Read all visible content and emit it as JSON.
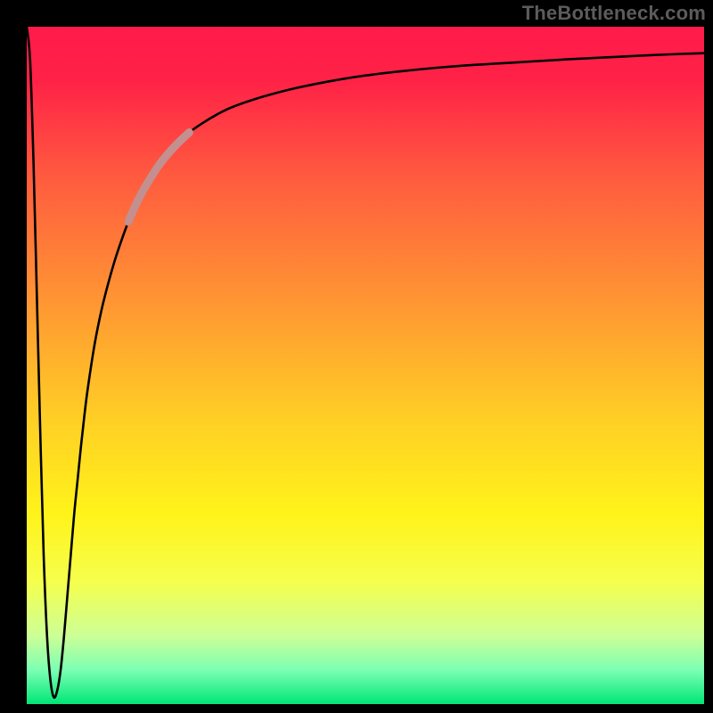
{
  "watermark": "TheBottleneck.com",
  "chart_data": {
    "type": "line",
    "title": "",
    "xlabel": "",
    "ylabel": "",
    "xlim": [
      0,
      100
    ],
    "ylim": [
      0,
      100
    ],
    "gradient_stops": [
      {
        "pos": 0.0,
        "color": "#ff1a4a"
      },
      {
        "pos": 0.08,
        "color": "#ff2247"
      },
      {
        "pos": 0.22,
        "color": "#ff5a3f"
      },
      {
        "pos": 0.4,
        "color": "#ff9433"
      },
      {
        "pos": 0.58,
        "color": "#ffcf25"
      },
      {
        "pos": 0.72,
        "color": "#fff31a"
      },
      {
        "pos": 0.82,
        "color": "#f5ff4d"
      },
      {
        "pos": 0.9,
        "color": "#ccff97"
      },
      {
        "pos": 0.95,
        "color": "#7bffb3"
      },
      {
        "pos": 1.0,
        "color": "#00e676"
      }
    ],
    "series": [
      {
        "name": "curve",
        "color": "#000000",
        "highlight_color": "#c48f8f",
        "highlight_range_x": [
          15,
          24
        ],
        "x": [
          0.0,
          0.5,
          1.0,
          1.5,
          2.0,
          2.5,
          3.0,
          3.5,
          4.0,
          4.5,
          5.0,
          5.5,
          6.0,
          6.5,
          7.0,
          7.5,
          8.0,
          8.5,
          9.0,
          10.0,
          11.0,
          12.0,
          13.0,
          14.0,
          15.0,
          16.0,
          17.0,
          18.0,
          19.0,
          20.0,
          22.0,
          24.0,
          26.0,
          28.0,
          30.0,
          33.0,
          36.0,
          40.0,
          45.0,
          50.0,
          55.0,
          60.0,
          65.0,
          70.0,
          75.0,
          80.0,
          85.0,
          90.0,
          95.0,
          100.0
        ],
        "y": [
          100.0,
          95.0,
          80.0,
          60.0,
          40.0,
          22.0,
          10.0,
          3.5,
          1.0,
          2.0,
          5.0,
          10.0,
          16.0,
          22.0,
          28.0,
          33.0,
          38.0,
          42.5,
          46.5,
          53.0,
          58.0,
          62.0,
          65.5,
          68.5,
          71.2,
          73.5,
          75.5,
          77.2,
          78.8,
          80.2,
          82.5,
          84.4,
          85.8,
          87.0,
          88.0,
          89.1,
          90.0,
          91.0,
          92.0,
          92.8,
          93.4,
          93.9,
          94.3,
          94.6,
          94.9,
          95.2,
          95.45,
          95.7,
          95.92,
          96.1
        ]
      }
    ]
  }
}
